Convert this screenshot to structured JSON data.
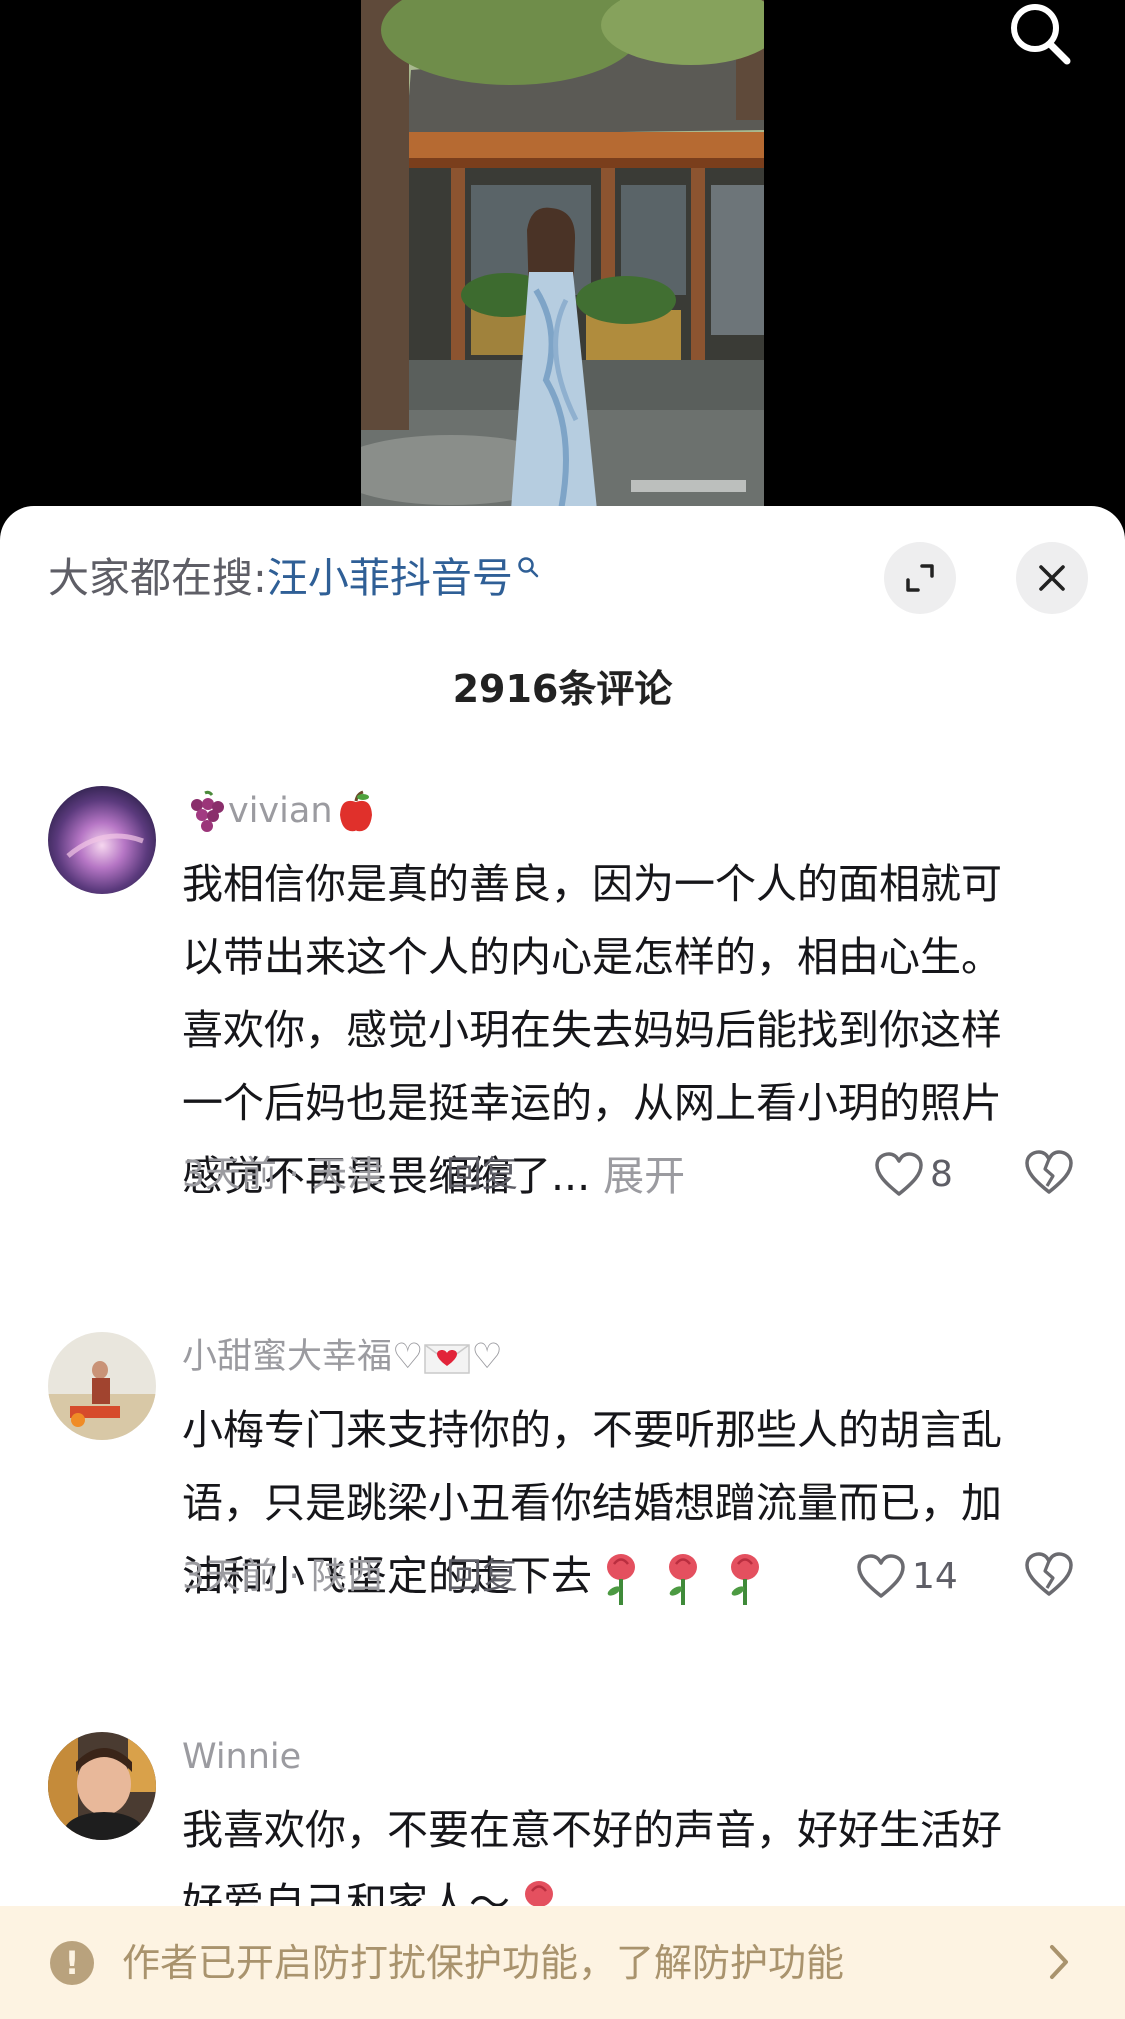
{
  "header": {
    "hot_search_prefix": "大家都在搜:",
    "hot_search_term": "汪小菲抖音号"
  },
  "comment_count": "2916条评论",
  "comments": [
    {
      "username": "vivian",
      "username_emoji_before": "grape-emoji",
      "username_emoji_after": "apple-emoji",
      "text": "我相信你是真的善良，因为一个人的面相就可\n以带出来这个人的内心是怎样的，相由心生。\n喜欢你，感觉小玥在失去妈妈后能找到你这样\n一个后妈也是挺幸运的，从网上看小玥的照片\n感觉不再畏畏缩缩了...",
      "more_label": "展开",
      "time_location": "3天前 · 天津",
      "reply_label": "回复",
      "likes": "8"
    },
    {
      "username": "小甜蜜大幸福♡",
      "username_emoji_after": "love-letter-emoji",
      "username_suffix": "♡",
      "text": "小梅专门来支持你的，不要听那些人的胡言乱\n语，只是跳梁小丑看你结婚想蹭流量而已，加\n油和小飞坚定的走下去",
      "text_emojis": [
        "rose-emoji",
        "rose-emoji",
        "rose-emoji"
      ],
      "time_location": "3天前 · 陕西",
      "reply_label": "回复",
      "likes": "14"
    },
    {
      "username": "Winnie",
      "text": "我喜欢你，不要在意不好的声音，好好生活好\n好爱自己和家人～",
      "text_emojis": [
        "rose-emoji"
      ]
    }
  ],
  "notice": {
    "text": "作者已开启防打扰保护功能，了解防护功能"
  },
  "colors": {
    "link_blue": "#2f5f96",
    "meta_gray": "#9b9ba0",
    "notice_bg": "#fdf3e2",
    "notice_text": "#a9936d"
  }
}
